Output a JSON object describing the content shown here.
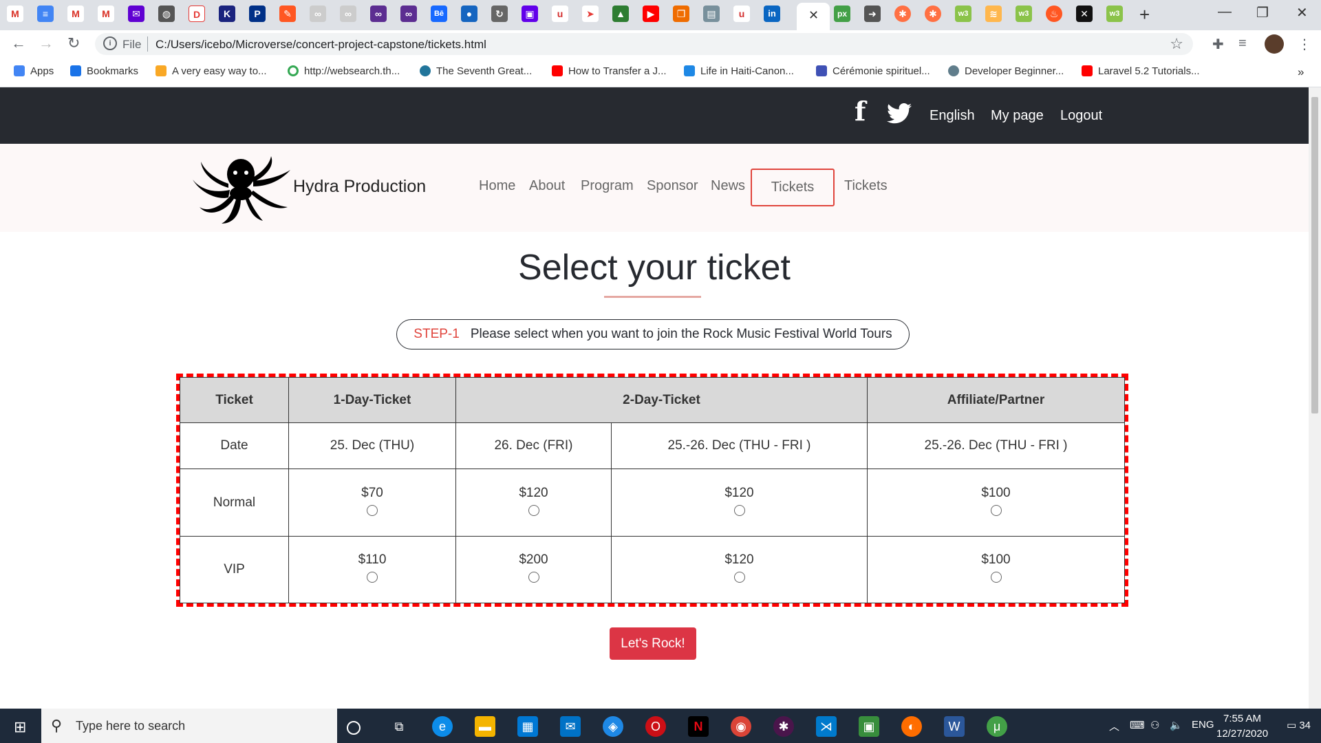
{
  "browser": {
    "url_scheme": "File",
    "url": "C:/Users/icebo/Microverse/concert-project-capstone/tickets.html",
    "bookmarks": [
      "Apps",
      "Bookmarks",
      "A very easy way to...",
      "http://websearch.th...",
      "The Seventh Great...",
      "How to Transfer a J...",
      "Life in Haiti-Canon...",
      "Cérémonie spirituel...",
      "Developer Beginner...",
      "Laravel 5.2 Tutorials..."
    ]
  },
  "topbar": {
    "language": "English",
    "mypage": "My page",
    "logout": "Logout"
  },
  "header": {
    "brand": "Hydra Production",
    "nav": [
      "Home",
      "About",
      "Program",
      "Sponsor",
      "News",
      "Tickets",
      "Tickets"
    ]
  },
  "main": {
    "title": "Select your ticket",
    "step_label": "STEP-1",
    "step_text": "Please select when you want to join the Rock Music Festival World Tours",
    "table": {
      "headers": [
        "Ticket",
        "1-Day-Ticket",
        "2-Day-Ticket",
        "Affiliate/Partner"
      ],
      "date_label": "Date",
      "dates": [
        "25. Dec (THU)",
        "26. Dec (FRI)",
        "25.-26. Dec (THU - FRI )",
        "25.-26. Dec (THU - FRI )"
      ],
      "rows": [
        {
          "label": "Normal",
          "prices": [
            "$70",
            "$120",
            "$120",
            "$100"
          ]
        },
        {
          "label": "VIP",
          "prices": [
            "$110",
            "$200",
            "$120",
            "$100"
          ]
        }
      ]
    },
    "button": "Let's Rock!"
  },
  "taskbar": {
    "search_placeholder": "Type here to search",
    "lang": "ENG",
    "time": "7:55 AM",
    "date": "12/27/2020",
    "notifications": "34"
  }
}
